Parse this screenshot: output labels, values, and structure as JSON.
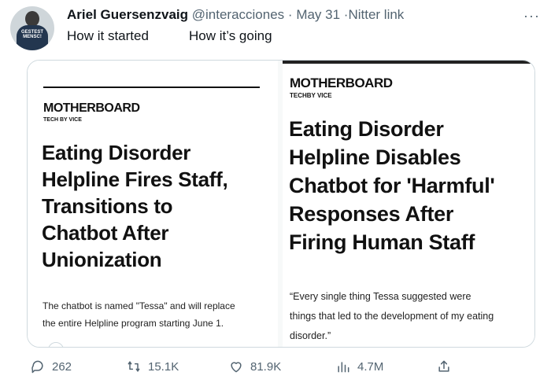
{
  "tweet": {
    "author_name": "Ariel Guersenzvaig",
    "handle": "@interacciones",
    "separator": " · ",
    "date": "May 31",
    "source_link": "·Nitter link",
    "avatar_shirt_text": "GESTEST MENSC!",
    "text_left": "How it started",
    "text_right": "How it’s going",
    "more": "···"
  },
  "left_card": {
    "brand": "MOTHERBOARD",
    "sub": "TECH BY VICE",
    "headline_lines": [
      "Eating Disorder",
      "Helpline Fires Staff,",
      "Transitions to",
      "Chatbot After",
      "Unionization"
    ],
    "caption_lines": [
      "The chatbot is named \"Tessa\" and will replace",
      "the entire Helpline program starting June 1."
    ]
  },
  "right_card": {
    "brand": "MOTHERBOARD",
    "sub": "TECHBY VICE",
    "headline_lines": [
      "Eating Disorder",
      "Helpline Disables",
      "Chatbot for 'Harmful'",
      "Responses After",
      "Firing Human Staff"
    ],
    "caption_lines": [
      "“Every single thing Tessa suggested were",
      "things that led to the development of my eating",
      "disorder.”"
    ]
  },
  "actions": {
    "replies": "262",
    "retweets": "15.1K",
    "likes": "81.9K",
    "views": "4.7M"
  },
  "icons": {
    "reply": "reply-icon",
    "retweet": "retweet-icon",
    "like": "heart-icon",
    "views": "views-icon",
    "share": "share-icon",
    "more": "more-icon"
  }
}
